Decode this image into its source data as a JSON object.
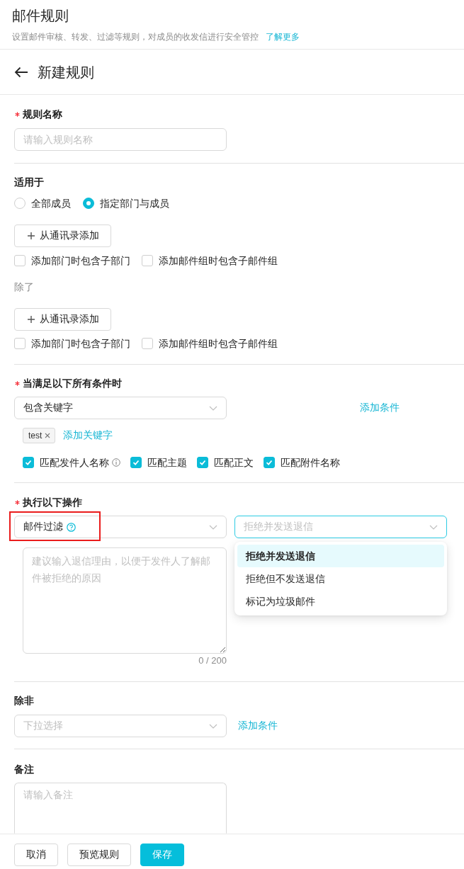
{
  "header": {
    "title": "邮件规则",
    "description": "设置邮件审核、转发、过滤等规则，对成员的收发信进行安全管控",
    "link": "了解更多"
  },
  "form_title": "新建规则",
  "rule_name": {
    "label": "规则名称",
    "required": true,
    "placeholder": "请输入规则名称"
  },
  "applies_to": {
    "label": "适用于",
    "required": false,
    "options": [
      {
        "label": "全部成员",
        "selected": false
      },
      {
        "label": "指定部门与成员",
        "selected": true
      }
    ],
    "add_button": "从通讯录添加",
    "checkboxes": [
      {
        "label": "添加部门时包含子部门",
        "checked": false
      },
      {
        "label": "添加邮件组时包含子邮件组",
        "checked": false
      }
    ],
    "except_label": "除了",
    "except_add_button": "从通讯录添加",
    "except_checkboxes": [
      {
        "label": "添加部门时包含子部门",
        "checked": false
      },
      {
        "label": "添加邮件组时包含子邮件组",
        "checked": false
      }
    ]
  },
  "conditions": {
    "label": "当满足以下所有条件时",
    "required": true,
    "select": {
      "value": "包含关键字"
    },
    "add_link": "添加条件",
    "tags": [
      {
        "label": "test"
      }
    ],
    "add_tag_link": "添加关键字",
    "matches": [
      {
        "label": "匹配发件人名称",
        "checked": true,
        "info": true
      },
      {
        "label": "匹配主题",
        "checked": true,
        "info": false
      },
      {
        "label": "匹配正文",
        "checked": true,
        "info": false
      },
      {
        "label": "匹配附件名称",
        "checked": true,
        "info": false
      }
    ]
  },
  "actions": {
    "label": "执行以下操作",
    "required": true,
    "type_select": {
      "value": "邮件过滤",
      "help": true,
      "highlighted": true
    },
    "mode_select": {
      "placeholder": "拒绝并发送退信",
      "focused": true,
      "options": [
        {
          "label": "拒绝并发送退信",
          "selected": true
        },
        {
          "label": "拒绝但不发送退信",
          "selected": false
        },
        {
          "label": "标记为垃圾邮件",
          "selected": false
        }
      ]
    },
    "reason": {
      "placeholder": "建议输入退信理由，以便于发件人了解邮件被拒绝的原因",
      "counter": "0 / 200"
    }
  },
  "exceptions": {
    "label": "除非",
    "required": false,
    "select": {
      "placeholder": "下拉选择"
    },
    "add_link": "添加条件"
  },
  "remark": {
    "label": "备注",
    "required": false,
    "placeholder": "请输入备注"
  },
  "footer": {
    "buttons": [
      {
        "label": "取消",
        "kind": "default"
      },
      {
        "label": "预览规则",
        "kind": "default"
      },
      {
        "label": "保存",
        "kind": "primary"
      }
    ]
  }
}
